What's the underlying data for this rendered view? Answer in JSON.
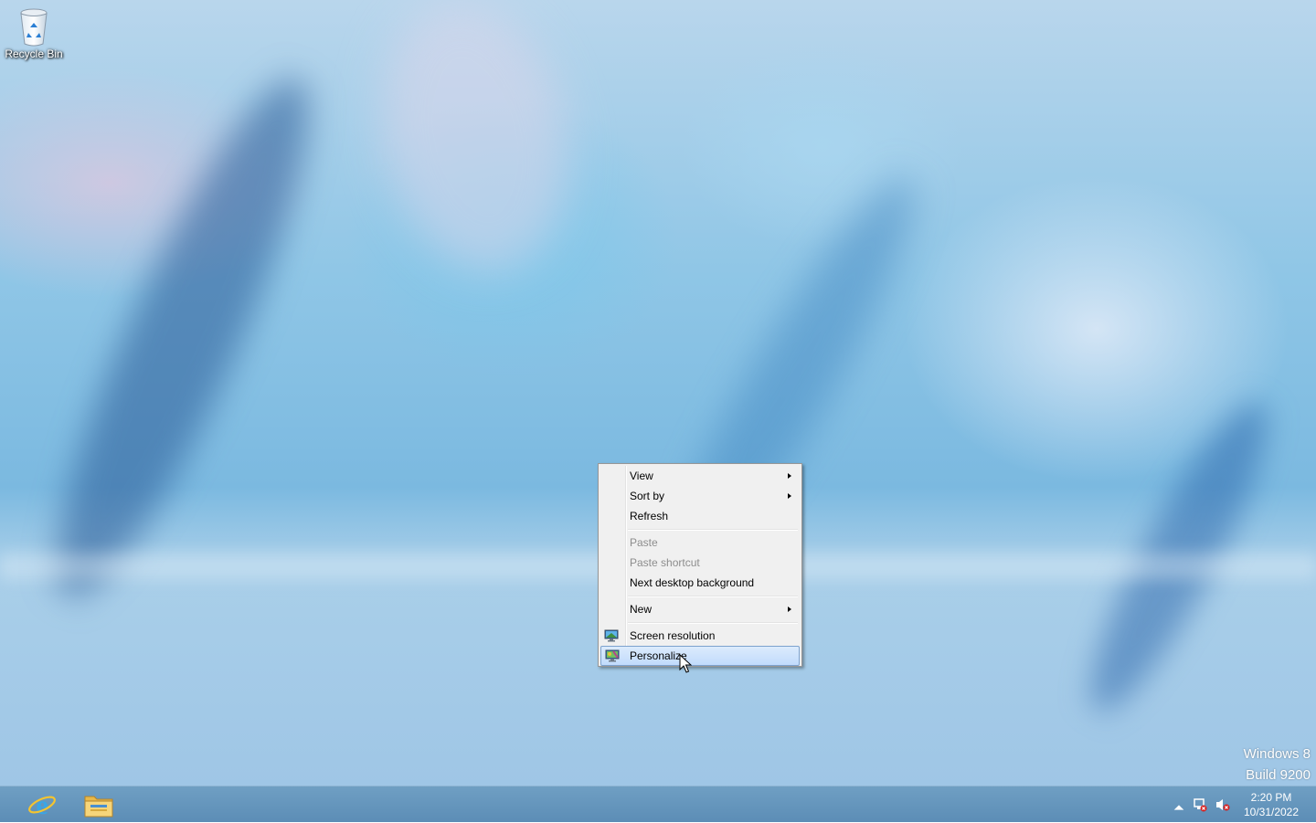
{
  "desktop": {
    "icons": [
      {
        "label": "Recycle Bin",
        "icon": "recycle-bin-icon"
      }
    ],
    "watermark": {
      "line1": "Windows 8",
      "line2": "Build 9200"
    }
  },
  "context_menu": {
    "items": [
      {
        "label": "View",
        "submenu": true,
        "enabled": true
      },
      {
        "label": "Sort by",
        "submenu": true,
        "enabled": true
      },
      {
        "label": "Refresh",
        "submenu": false,
        "enabled": true
      },
      {
        "label": "Paste",
        "submenu": false,
        "enabled": false
      },
      {
        "label": "Paste shortcut",
        "submenu": false,
        "enabled": false
      },
      {
        "label": "Next desktop background",
        "submenu": false,
        "enabled": true
      },
      {
        "label": "New",
        "submenu": true,
        "enabled": true
      },
      {
        "label": "Screen resolution",
        "icon": "screen-resolution-icon",
        "enabled": true
      },
      {
        "label": "Personalize",
        "icon": "personalize-icon",
        "enabled": true,
        "highlighted": true
      }
    ]
  },
  "taskbar": {
    "pinned": [
      {
        "name": "Internet Explorer",
        "icon": "internet-explorer-icon"
      },
      {
        "name": "File Explorer",
        "icon": "file-explorer-icon"
      }
    ],
    "tray": {
      "icons": [
        "show-hidden-icons-chevron",
        "network-disconnected-icon",
        "volume-muted-icon"
      ],
      "time": "2:20 PM",
      "date": "10/31/2022"
    }
  },
  "colors": {
    "taskbar": "#6a9bc1",
    "menu_background": "#f0f0f0",
    "menu_highlight": "#c1dbfc"
  }
}
